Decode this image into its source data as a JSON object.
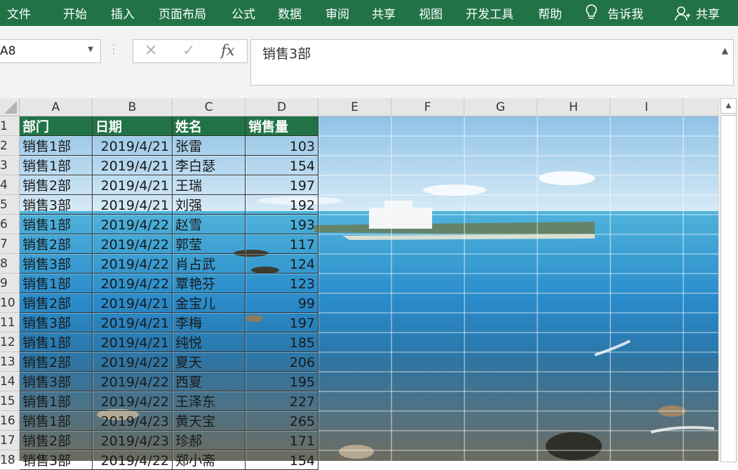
{
  "menu": [
    "文件",
    "开始",
    "插入",
    "页面布局",
    "公式",
    "数据",
    "审阅",
    "共享",
    "视图",
    "开发工具",
    "帮助"
  ],
  "tell_me": "告诉我",
  "share": "共享",
  "name_box": "A8",
  "fx_label": "fx",
  "formula_value": "销售3部",
  "columns": [
    "A",
    "B",
    "C",
    "D",
    "E",
    "F",
    "G",
    "H",
    "I"
  ],
  "rows": [
    "1",
    "2",
    "3",
    "4",
    "5",
    "6",
    "7",
    "8",
    "9",
    "10",
    "11",
    "12",
    "13",
    "14",
    "15",
    "16",
    "17",
    "18"
  ],
  "table_header": [
    "部门",
    "日期",
    "姓名",
    "销售量"
  ],
  "table_rows": [
    [
      "销售1部",
      "2019/4/21",
      "张雷",
      "103"
    ],
    [
      "销售1部",
      "2019/4/21",
      "李白瑟",
      "154"
    ],
    [
      "销售2部",
      "2019/4/21",
      "王瑞",
      "197"
    ],
    [
      "销售3部",
      "2019/4/21",
      "刘强",
      "192"
    ],
    [
      "销售1部",
      "2019/4/22",
      "赵雪",
      "193"
    ],
    [
      "销售2部",
      "2019/4/22",
      "郭莹",
      "117"
    ],
    [
      "销售3部",
      "2019/4/22",
      "肖占武",
      "124"
    ],
    [
      "销售1部",
      "2019/4/22",
      "覃艳芬",
      "123"
    ],
    [
      "销售2部",
      "2019/4/21",
      "金宝儿",
      "99"
    ],
    [
      "销售3部",
      "2019/4/21",
      "李梅",
      "197"
    ],
    [
      "销售1部",
      "2019/4/21",
      "纯悦",
      "185"
    ],
    [
      "销售2部",
      "2019/4/22",
      "夏天",
      "206"
    ],
    [
      "销售3部",
      "2019/4/22",
      "西夏",
      "195"
    ],
    [
      "销售1部",
      "2019/4/22",
      "王泽东",
      "227"
    ],
    [
      "销售1部",
      "2019/4/23",
      "黄天宝",
      "265"
    ],
    [
      "销售2部",
      "2019/4/23",
      "珍郝",
      "171"
    ],
    [
      "销售3部",
      "2019/4/22",
      "郑小斋",
      "154"
    ]
  ],
  "colors": {
    "accent": "#217346",
    "sea": "#2f8fc8",
    "sky": "#d7e9f5"
  }
}
